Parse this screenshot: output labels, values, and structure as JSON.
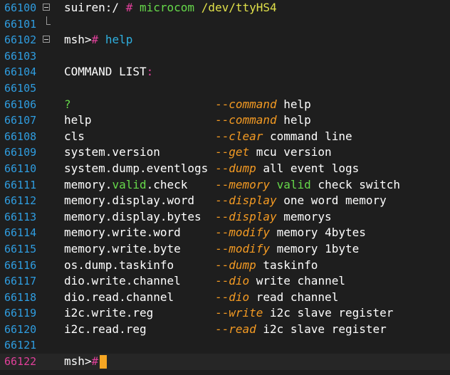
{
  "line_numbers": [
    "66100",
    "66101",
    "66102",
    "66103",
    "66104",
    "66105",
    "66106",
    "66107",
    "66108",
    "66109",
    "66110",
    "66111",
    "66112",
    "66113",
    "66114",
    "66115",
    "66116",
    "66117",
    "66118",
    "66119",
    "66120",
    "66121",
    "66122"
  ],
  "prompt_line": {
    "host": "suiren:/",
    "hash": "#",
    "command": "microcom",
    "device": "/dev/ttyHS4"
  },
  "help_line": {
    "prompt": "msh>",
    "hash": "#",
    "command": "help"
  },
  "header": {
    "label": "COMMAND LIST",
    "colon": ":"
  },
  "commands": [
    {
      "name": [
        "?"
      ],
      "name_green": true,
      "dash": "--",
      "keyword": "command",
      "rest": " help"
    },
    {
      "name": [
        "help"
      ],
      "dash": "--",
      "keyword": "command",
      "rest": " help"
    },
    {
      "name": [
        "cls"
      ],
      "dash": "--",
      "keyword": "clear",
      "rest": " command line"
    },
    {
      "name": [
        "system.version"
      ],
      "dash": "--",
      "keyword": "get",
      "rest": " mcu version"
    },
    {
      "name": [
        "system.dump.eventlogs"
      ],
      "dash": "--",
      "keyword": "dump",
      "rest": " all event logs"
    },
    {
      "name": [
        "memory.",
        "valid",
        ".check"
      ],
      "dash": "--",
      "keyword": "memory",
      "rest_green": " valid",
      "rest": " check switch"
    },
    {
      "name": [
        "memory.display.word"
      ],
      "dash": "--",
      "keyword": "display",
      "rest": " one word memory"
    },
    {
      "name": [
        "memory.display.bytes"
      ],
      "dash": "--",
      "keyword": "display",
      "rest": " memorys"
    },
    {
      "name": [
        "memory.write.word"
      ],
      "dash": "--",
      "keyword": "modify",
      "rest": " memory 4bytes"
    },
    {
      "name": [
        "memory.write.byte"
      ],
      "dash": "--",
      "keyword": "modify",
      "rest": " memory 1byte"
    },
    {
      "name": [
        "os.dump.taskinfo"
      ],
      "dash": "--",
      "keyword": "dump",
      "rest": " taskinfo"
    },
    {
      "name": [
        "dio.write.channel"
      ],
      "dash": "--",
      "keyword": "dio",
      "rest": " write channel"
    },
    {
      "name": [
        "dio.read.channel"
      ],
      "dash": "--",
      "keyword": "dio",
      "rest": " read channel"
    },
    {
      "name": [
        "i2c.write.reg"
      ],
      "dash": "--",
      "keyword": "write",
      "rest": " i2c slave register"
    },
    {
      "name": [
        "i2c.read.reg"
      ],
      "dash": "--",
      "keyword": "read",
      "rest": " i2c slave register"
    }
  ],
  "final_prompt": {
    "prompt": "msh>",
    "hash": "#"
  }
}
